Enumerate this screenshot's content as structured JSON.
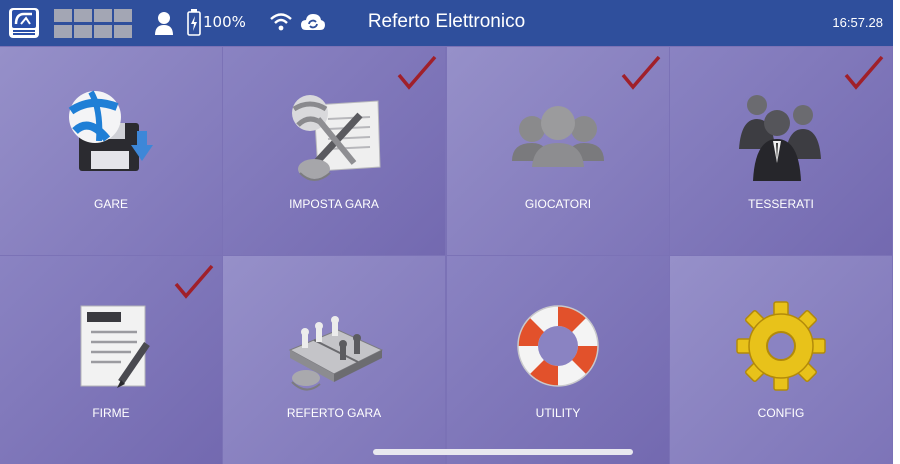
{
  "header": {
    "title": "Referto Elettronico",
    "battery": "100%",
    "clock": "16:57.28"
  },
  "tiles": [
    {
      "label": "GARE",
      "checked": false
    },
    {
      "label": "IMPOSTA GARA",
      "checked": true
    },
    {
      "label": "GIOCATORI",
      "checked": true
    },
    {
      "label": "TESSERATI",
      "checked": true
    },
    {
      "label": "FIRME",
      "checked": true
    },
    {
      "label": "REFERTO GARA",
      "checked": false
    },
    {
      "label": "UTILITY",
      "checked": false
    },
    {
      "label": "CONFIG",
      "checked": false
    }
  ],
  "colors": {
    "header_bg": "#2f4f9c",
    "tile_bg": "#8a83c2",
    "check": "#a0202a"
  }
}
